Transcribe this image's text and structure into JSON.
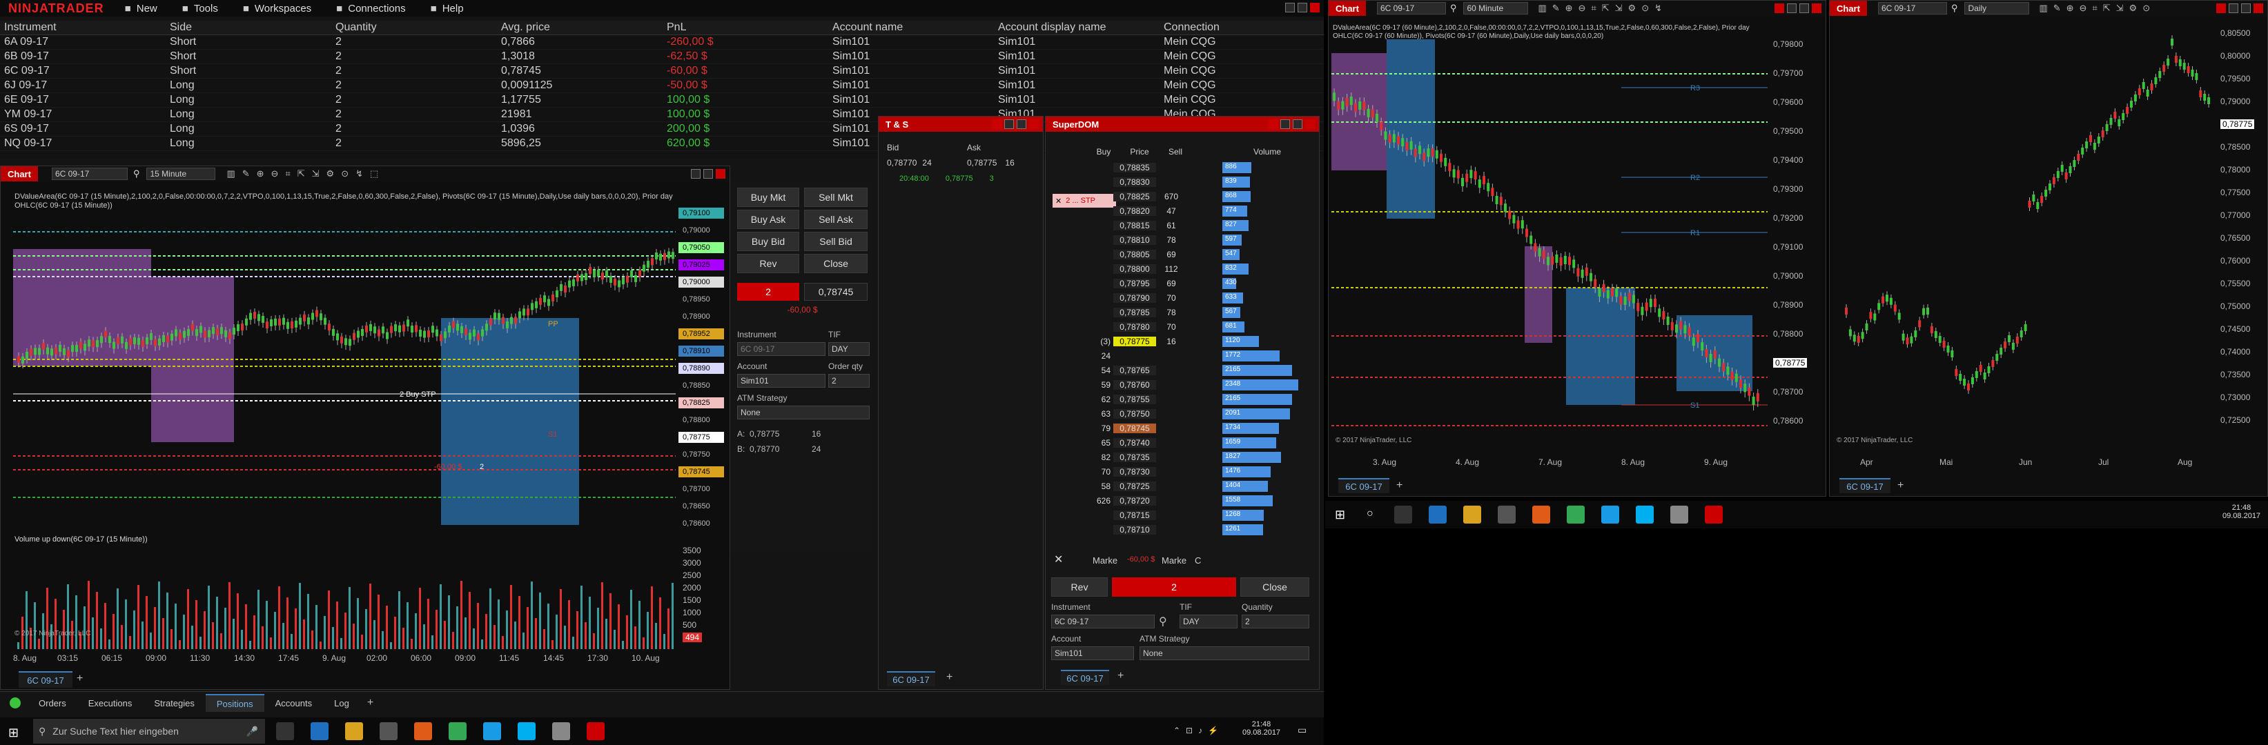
{
  "app": {
    "logo": "NINJATRADER",
    "menu": [
      {
        "label": "New",
        "icon": "new-icon"
      },
      {
        "label": "Tools",
        "icon": "tools-icon"
      },
      {
        "label": "Workspaces",
        "icon": "workspaces-icon"
      },
      {
        "label": "Connections",
        "icon": "connections-icon"
      },
      {
        "label": "Help",
        "icon": "help-icon"
      }
    ]
  },
  "positions": {
    "headers": [
      "Instrument",
      "Side",
      "Quantity",
      "Avg. price",
      "PnL",
      "Account name",
      "Account display name",
      "Connection"
    ],
    "rows": [
      [
        "6A 09-17",
        "Short",
        "2",
        "0,7866",
        "-260,00 $",
        "Sim101",
        "Sim101",
        "Mein CQG"
      ],
      [
        "6B 09-17",
        "Short",
        "2",
        "1,3018",
        "-62,50 $",
        "Sim101",
        "Sim101",
        "Mein CQG"
      ],
      [
        "6C 09-17",
        "Short",
        "2",
        "0,78745",
        "-60,00 $",
        "Sim101",
        "Sim101",
        "Mein CQG"
      ],
      [
        "6J 09-17",
        "Long",
        "2",
        "0,0091125",
        "-50,00 $",
        "Sim101",
        "Sim101",
        "Mein CQG"
      ],
      [
        "6E 09-17",
        "Long",
        "2",
        "1,17755",
        "100,00 $",
        "Sim101",
        "Sim101",
        "Mein CQG"
      ],
      [
        "YM 09-17",
        "Long",
        "2",
        "21981",
        "100,00 $",
        "Sim101",
        "Sim101",
        "Mein CQG"
      ],
      [
        "6S 09-17",
        "Long",
        "2",
        "1,0396",
        "200,00 $",
        "Sim101",
        "Sim101",
        "Mein CQG"
      ],
      [
        "NQ 09-17",
        "Long",
        "2",
        "5896,25",
        "620,00 $",
        "Sim101",
        "Sim101",
        "Mein CQG"
      ]
    ],
    "pnl_colors": [
      "red",
      "red",
      "red",
      "red",
      "green",
      "green",
      "green",
      "green"
    ],
    "tabs": [
      "Orders",
      "Executions",
      "Strategies",
      "Positions",
      "Accounts",
      "Log"
    ],
    "active_tab": "Positions"
  },
  "chart1": {
    "title": "Chart",
    "instrument": "6C 09-17",
    "interval": "15 Minute",
    "indicator_text": "DValueArea(6C 09-17 (15 Minute),2,100,2,0,False,00:00:00,0,7,2,2,VTPO,0,100,1,13,15,True,2,False,0,60,300,False,2,False), Pivots(6C 09-17 (15 Minute),Daily,Use daily bars,0,0,0,20), Prior day OHLC(6C 09-17 (15 Minute))",
    "price_labels": [
      "0,79100",
      "0,79000",
      "0,79050",
      "0,79025",
      "0,79000",
      "0,78950",
      "0,78900",
      "0,78952",
      "0,78910",
      "0,78890",
      "0,78850",
      "0,78825",
      "0,78800",
      "0,78775",
      "0,78750",
      "0,78745",
      "0,78700",
      "0,78650",
      "0,78600"
    ],
    "order_label": "2 Buy STP",
    "pos_label": "-60,00 $",
    "pos_qty": "2",
    "volume_title": "Volume up down(6C 09-17 (15 Minute))",
    "volume_axis": [
      "3500",
      "3000",
      "2500",
      "2000",
      "1500",
      "1000",
      "500",
      "494"
    ],
    "time_axis": [
      "8. Aug",
      "03:15",
      "06:15",
      "09:00",
      "11:30",
      "14:30",
      "17:45",
      "9. Aug",
      "02:00",
      "06:00",
      "09:00",
      "11:45",
      "14:45",
      "17:30",
      "10. Aug"
    ],
    "copyright": "© 2017 NinjaTrader, LLC",
    "tab": "6C 09-17",
    "pivot_label": "PP",
    "s1_label": "S1"
  },
  "chart_trader": {
    "buy_mkt": "Buy Mkt",
    "sell_mkt": "Sell Mkt",
    "buy_ask": "Buy Ask",
    "sell_ask": "Sell Ask",
    "buy_bid": "Buy Bid",
    "sell_bid": "Sell Bid",
    "rev": "Rev",
    "close": "Close",
    "position_qty": "2",
    "position_price": "0,78745",
    "pnl": "-60,00 $",
    "instrument_label": "Instrument",
    "instrument": "6C 09-17",
    "tif_label": "TIF",
    "tif": "DAY",
    "account_label": "Account",
    "account": "Sim101",
    "qty_label": "Order qty",
    "qty": "2",
    "atm_label": "ATM Strategy",
    "atm": "None",
    "ask_label": "A:",
    "ask_price": "0,78775",
    "ask_size": "16",
    "bid_label": "B:",
    "bid_price": "0,78770",
    "bid_size": "24"
  },
  "ts": {
    "title": "T & S",
    "headers": [
      "Bid",
      "Ask"
    ],
    "row1": {
      "bid": "0,78770",
      "bid_size": "24",
      "ask": "0,78775",
      "ask_size": "16"
    },
    "row2": {
      "time": "20:48:00",
      "price": "0,78775",
      "size": "3"
    },
    "tab": "6C 09-17"
  },
  "superdom": {
    "title": "SuperDOM",
    "headers": [
      "Buy",
      "Price",
      "Sell",
      "Volume"
    ],
    "stp_label": "2 ... STP",
    "rows": [
      {
        "buy": "",
        "price": "0,78835",
        "sell": "",
        "vol": "886",
        "w": 0.35
      },
      {
        "buy": "",
        "price": "0,78830",
        "sell": "",
        "vol": "839",
        "w": 0.33
      },
      {
        "buy": "",
        "price": "0,78825",
        "sell": "670",
        "vol": "868",
        "w": 0.34
      },
      {
        "buy": "",
        "price": "0,78820",
        "sell": "47",
        "vol": "774",
        "w": 0.3
      },
      {
        "buy": "",
        "price": "0,78815",
        "sell": "61",
        "vol": "827",
        "w": 0.32
      },
      {
        "buy": "",
        "price": "0,78810",
        "sell": "78",
        "vol": "597",
        "w": 0.23
      },
      {
        "buy": "",
        "price": "0,78805",
        "sell": "69",
        "vol": "547",
        "w": 0.21
      },
      {
        "buy": "",
        "price": "0,78800",
        "sell": "112",
        "vol": "832",
        "w": 0.32
      },
      {
        "buy": "",
        "price": "0,78795",
        "sell": "69",
        "vol": "430",
        "w": 0.17
      },
      {
        "buy": "",
        "price": "0,78790",
        "sell": "70",
        "vol": "633",
        "w": 0.25
      },
      {
        "buy": "",
        "price": "0,78785",
        "sell": "78",
        "vol": "567",
        "w": 0.22
      },
      {
        "buy": "",
        "price": "0,78780",
        "sell": "70",
        "vol": "681",
        "w": 0.27
      },
      {
        "buy": "(3)",
        "price": "0,78775",
        "sell": "16",
        "vol": "1120",
        "w": 0.44
      },
      {
        "buy": "24",
        "price": "",
        "sell": "",
        "vol": "1772",
        "w": 0.69
      },
      {
        "buy": "54",
        "price": "0,78765",
        "sell": "",
        "vol": "2165",
        "w": 0.84
      },
      {
        "buy": "59",
        "price": "0,78760",
        "sell": "",
        "vol": "2348",
        "w": 0.92
      },
      {
        "buy": "62",
        "price": "0,78755",
        "sell": "",
        "vol": "2165",
        "w": 0.84
      },
      {
        "buy": "63",
        "price": "0,78750",
        "sell": "",
        "vol": "2091",
        "w": 0.82
      },
      {
        "buy": "79",
        "price": "0,78745",
        "sell": "",
        "vol": "1734",
        "w": 0.68
      },
      {
        "buy": "65",
        "price": "0,78740",
        "sell": "",
        "vol": "1659",
        "w": 0.65
      },
      {
        "buy": "82",
        "price": "0,78735",
        "sell": "",
        "vol": "1827",
        "w": 0.71
      },
      {
        "buy": "70",
        "price": "0,78730",
        "sell": "",
        "vol": "1476",
        "w": 0.58
      },
      {
        "buy": "58",
        "price": "0,78725",
        "sell": "",
        "vol": "1404",
        "w": 0.55
      },
      {
        "buy": "626",
        "price": "0,78720",
        "sell": "",
        "vol": "1558",
        "w": 0.61
      },
      {
        "buy": "",
        "price": "0,78715",
        "sell": "",
        "vol": "1268",
        "w": 0.5
      },
      {
        "buy": "",
        "price": "0,78710",
        "sell": "",
        "vol": "1261",
        "w": 0.49
      }
    ],
    "market_label": "Marke",
    "market_pnl": "-60,00 $",
    "c_label": "C",
    "rev": "Rev",
    "qty": "2",
    "close": "Close",
    "instrument_label": "Instrument",
    "instrument": "6C 09-17",
    "tif_label": "TIF",
    "tif": "DAY",
    "quantity_label": "Quantity",
    "quantity": "2",
    "account_label": "Account",
    "account": "Sim101",
    "atm_label": "ATM Strategy",
    "atm": "None",
    "tab": "6C 09-17"
  },
  "chart2": {
    "title": "Chart",
    "instrument": "6C 09-17",
    "interval": "60 Minute",
    "indicator_text": "DValueArea(6C 09-17 (60 Minute),2,100,2,0,False,00:00:00,0,7,2,2,VTPO,0,100,1,13,15,True,2,False,0,60,300,False,2,False), Prior day OHLC(6C 09-17 (60 Minute)), Pivots(6C 09-17 (60 Minute),Daily,Use daily bars,0,0,0,20)",
    "price_labels": [
      "0,79800",
      "0,79700",
      "0,79600",
      "0,79500",
      "0,79400",
      "0,79300",
      "0,79200",
      "0,79100",
      "0,79000",
      "0,78900",
      "0,78800",
      "0,78775",
      "0,78700",
      "0,78600"
    ],
    "time_axis": [
      "3. Aug",
      "4. Aug",
      "7. Aug",
      "8. Aug",
      "9. Aug"
    ],
    "pivot_labels": [
      "R3",
      "R2",
      "R1",
      "S1"
    ],
    "copyright": "© 2017 NinjaTrader, LLC",
    "tab": "6C 09-17"
  },
  "chart3": {
    "title": "Chart",
    "instrument": "6C 09-17",
    "interval": "Daily",
    "price_labels": [
      "0,80500",
      "0,80000",
      "0,79500",
      "0,79000",
      "0,78775",
      "0,78500",
      "0,78000",
      "0,77500",
      "0,77000",
      "0,76500",
      "0,76000",
      "0,75500",
      "0,75000",
      "0,74500",
      "0,74000",
      "0,73500",
      "0,73000",
      "0,72500"
    ],
    "time_axis": [
      "Apr",
      "Mai",
      "Jun",
      "Jul",
      "Aug"
    ],
    "copyright": "© 2017 NinjaTrader, LLC",
    "tab": "6C 09-17"
  },
  "taskbar_left": {
    "search_placeholder": "Zur Suche Text hier eingeben",
    "time": "21:48",
    "date": "09.08.2017"
  },
  "taskbar_right": {
    "time": "21:48",
    "date": "09.08.2017"
  },
  "colors": {
    "accent": "#c00000",
    "buy": "#1e6fbf",
    "profile_purple": "#8a4ea3",
    "profile_blue": "#2a6ea8",
    "volume_bar": "#4a90e2"
  }
}
